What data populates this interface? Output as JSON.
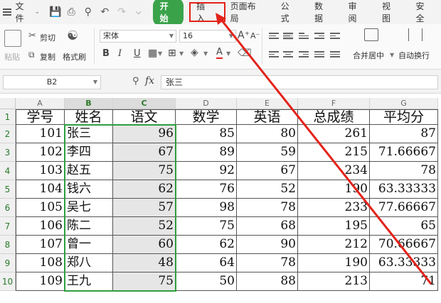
{
  "menubar": {
    "file_label": "文件",
    "quick_access_icons": [
      "save-icon",
      "print-icon",
      "print-preview-icon",
      "undo-icon",
      "redo-icon",
      "more-icon"
    ],
    "start_button": "开始",
    "tabs": [
      "插入",
      "页面布局",
      "公式",
      "数据",
      "审阅",
      "视图",
      "安全"
    ],
    "highlighted_tab": "插入",
    "highlight_color": "#e3221a",
    "start_color": "#3aa34a"
  },
  "ribbon": {
    "cut_label": "剪切",
    "paste_label": "粘贴",
    "copy_label": "复制",
    "format_painter_label": "格式刷",
    "font_name": "宋体",
    "font_size": "16",
    "bold": "B",
    "italic": "I",
    "underline": "U",
    "merge_center_label": "合并居中",
    "auto_wrap_label": "自动换行"
  },
  "formula_bar": {
    "cell_ref": "B2",
    "fx": "fx",
    "value": "张三"
  },
  "sheet": {
    "columns": [
      "A",
      "B",
      "C",
      "D",
      "E",
      "F",
      "G"
    ],
    "selected_columns": [
      "B",
      "C"
    ],
    "rows": [
      [
        "学号",
        "姓名",
        "语文",
        "数学",
        "英语",
        "总成绩",
        "平均分"
      ],
      [
        "101",
        "张三",
        "96",
        "85",
        "80",
        "261",
        "87"
      ],
      [
        "102",
        "李四",
        "67",
        "89",
        "59",
        "215",
        "71.66667"
      ],
      [
        "103",
        "赵五",
        "75",
        "92",
        "67",
        "234",
        "78"
      ],
      [
        "104",
        "钱六",
        "62",
        "76",
        "52",
        "190",
        "63.33333"
      ],
      [
        "105",
        "吴七",
        "57",
        "98",
        "78",
        "233",
        "77.66667"
      ],
      [
        "106",
        "陈二",
        "52",
        "75",
        "68",
        "195",
        "65"
      ],
      [
        "107",
        "曾一",
        "60",
        "62",
        "90",
        "212",
        "70.66667"
      ],
      [
        "108",
        "郑八",
        "48",
        "64",
        "78",
        "190",
        "63.33333"
      ],
      [
        "109",
        "王九",
        "75",
        "50",
        "88",
        "213",
        "71"
      ]
    ],
    "row_numbers": [
      "1",
      "2",
      "3",
      "4",
      "5",
      "6",
      "7",
      "8",
      "9",
      "10"
    ],
    "selection_color": "#2e9e3e"
  }
}
